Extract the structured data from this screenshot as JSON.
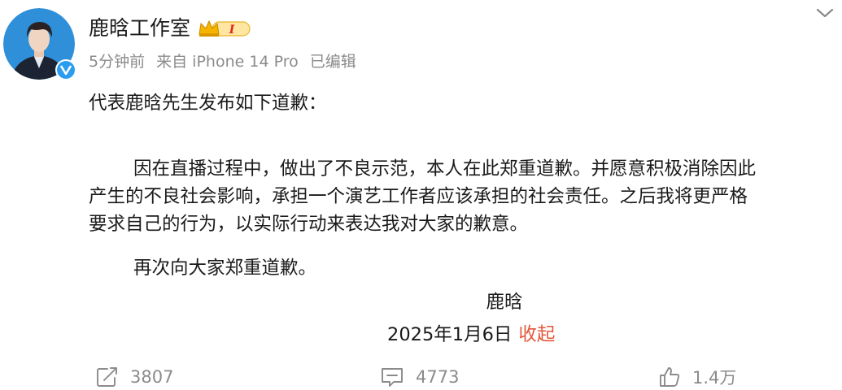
{
  "post": {
    "author": "鹿晗工作室",
    "vip_level": "I",
    "time": "5分钟前",
    "source": "来自 iPhone 14 Pro",
    "edited": "已编辑",
    "intro": "代表鹿晗先生发布如下道歉：",
    "body_lines": [
      "因在直播过程中，做出了不良示范，本人在此郑重道歉。并愿意积极消除因此",
      "产生的不良社会影响，承担一个演艺工作者应该承担的社会责任。之后我将更严格",
      "要求自己的行为，以实际行动来表达我对大家的歉意。"
    ],
    "closing": "再次向大家郑重道歉。",
    "signature": "鹿晗",
    "date": "2025年1月6日",
    "collapse_label": "收起"
  },
  "actions": {
    "repost_count": "3807",
    "comment_count": "4773",
    "like_count": "1.4万"
  },
  "colors": {
    "link": "#e3573b",
    "muted": "#8b8b8b",
    "verified": "#2b9df0",
    "vip_gold": "#f5b400"
  },
  "icons": [
    "avatar",
    "verified-badge-icon",
    "vip-crown-badge-icon",
    "chevron-down-icon",
    "repost-icon",
    "comment-icon",
    "like-icon"
  ]
}
